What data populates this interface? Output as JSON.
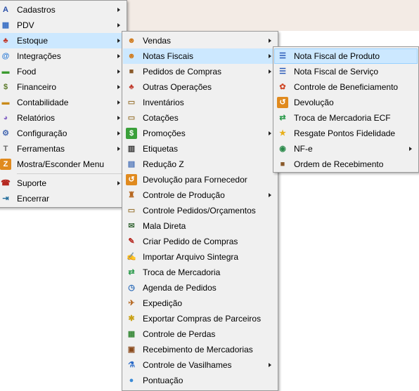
{
  "main_menu": {
    "items": [
      {
        "label": "Cadastros",
        "icon": "user-icon",
        "arrow": true
      },
      {
        "label": "PDV",
        "icon": "register-icon",
        "arrow": true
      },
      {
        "label": "Estoque",
        "icon": "stock-icon",
        "arrow": true,
        "open": true
      },
      {
        "label": "Integrações",
        "icon": "at-icon",
        "arrow": true
      },
      {
        "label": "Food",
        "icon": "basket-icon",
        "arrow": true
      },
      {
        "label": "Financeiro",
        "icon": "money-bag-icon",
        "arrow": true
      },
      {
        "label": "Contabilidade",
        "icon": "folder-icon",
        "arrow": true
      },
      {
        "label": "Relatórios",
        "icon": "chart-icon",
        "arrow": true
      },
      {
        "label": "Configuração",
        "icon": "gears-icon",
        "arrow": true
      },
      {
        "label": "Ferramentas",
        "icon": "hammer-icon",
        "arrow": true
      },
      {
        "label": "Mostra/Esconder Menu",
        "icon": "toggle-icon",
        "arrow": false
      },
      {
        "label": "Suporte",
        "icon": "phone-icon",
        "arrow": true,
        "separator_before": true
      },
      {
        "label": "Encerrar",
        "icon": "exit-icon",
        "arrow": false
      }
    ]
  },
  "estoque_menu": {
    "items": [
      {
        "label": "Vendas",
        "icon": "users-icon",
        "arrow": true
      },
      {
        "label": "Notas Fiscais",
        "icon": "users-icon",
        "arrow": true,
        "open": true
      },
      {
        "label": "Pedidos de Compras",
        "icon": "box-icon",
        "arrow": true
      },
      {
        "label": "Outras Operações",
        "icon": "stock-icon",
        "arrow": false
      },
      {
        "label": "Inventários",
        "icon": "clipboard-icon",
        "arrow": false
      },
      {
        "label": "Cotações",
        "icon": "clipboard-icon",
        "arrow": false
      },
      {
        "label": "Promoções",
        "icon": "dollar-icon",
        "arrow": true
      },
      {
        "label": "Etiquetas",
        "icon": "barcode-icon",
        "arrow": false
      },
      {
        "label": "Redução Z",
        "icon": "printer-icon",
        "arrow": false
      },
      {
        "label": "Devolução para Fornecedor",
        "icon": "return-icon",
        "arrow": false
      },
      {
        "label": "Controle de Produção",
        "icon": "production-icon",
        "arrow": true
      },
      {
        "label": "Controle Pedidos/Orçamentos",
        "icon": "clipboard-icon",
        "arrow": false
      },
      {
        "label": "Mala Direta",
        "icon": "mail-icon",
        "arrow": false
      },
      {
        "label": "Criar Pedido de Compras",
        "icon": "pen-icon",
        "arrow": false
      },
      {
        "label": "Importar Arquivo Sintegra",
        "icon": "import-icon",
        "arrow": false
      },
      {
        "label": "Troca de Mercadoria",
        "icon": "swap-icon",
        "arrow": false
      },
      {
        "label": "Agenda de Pedidos",
        "icon": "clock-icon",
        "arrow": false
      },
      {
        "label": "Expedição",
        "icon": "truck-icon",
        "arrow": false
      },
      {
        "label": "Exportar Compras de Parceiros",
        "icon": "bee-icon",
        "arrow": false
      },
      {
        "label": "Controle de Perdas",
        "icon": "sheet-icon",
        "arrow": false
      },
      {
        "label": "Recebimento de Mercadorias",
        "icon": "boxes-icon",
        "arrow": false
      },
      {
        "label": "Controle de Vasilhames",
        "icon": "flask-icon",
        "arrow": true
      },
      {
        "label": "Pontuação",
        "icon": "person-icon",
        "arrow": false
      }
    ]
  },
  "notas_menu": {
    "items": [
      {
        "label": "Nota Fiscal de Produto",
        "icon": "invoice-icon",
        "arrow": false,
        "highlight": true
      },
      {
        "label": "Nota Fiscal de Serviço",
        "icon": "invoice-icon",
        "arrow": false
      },
      {
        "label": "Controle de Beneficiamento",
        "icon": "cycle-icon",
        "arrow": false
      },
      {
        "label": "Devolução",
        "icon": "return-icon",
        "arrow": false
      },
      {
        "label": "Troca de Mercadoria ECF",
        "icon": "swap-icon",
        "arrow": false
      },
      {
        "label": "Resgate Pontos Fidelidade",
        "icon": "star-icon",
        "arrow": false
      },
      {
        "label": "NF-e",
        "icon": "globe-icon",
        "arrow": true
      },
      {
        "label": "Ordem de Recebimento",
        "icon": "box-icon",
        "arrow": false
      }
    ]
  },
  "icon_glyphs": {
    "user-icon": {
      "g": "A",
      "c": "#2a4fa8",
      "bg": "transparent"
    },
    "register-icon": {
      "g": "▦",
      "c": "#3a6fc4",
      "bg": "transparent"
    },
    "stock-icon": {
      "g": "♣",
      "c": "#c0392b",
      "bg": "transparent"
    },
    "at-icon": {
      "g": "@",
      "c": "#2c7bd6",
      "bg": "transparent"
    },
    "basket-icon": {
      "g": "▬",
      "c": "#3a9b2e",
      "bg": "transparent"
    },
    "money-bag-icon": {
      "g": "$",
      "c": "#5b7a2a",
      "bg": "transparent"
    },
    "folder-icon": {
      "g": "▬",
      "c": "#c98a1a",
      "bg": "transparent"
    },
    "chart-icon": {
      "g": "◕",
      "c": "#8a6cc8",
      "bg": "transparent"
    },
    "gears-icon": {
      "g": "⚙",
      "c": "#4a6cb3",
      "bg": "transparent"
    },
    "hammer-icon": {
      "g": "T",
      "c": "#6b6b6b",
      "bg": "transparent"
    },
    "toggle-icon": {
      "g": "Z",
      "c": "#ffffff",
      "bg": "#e08a1e"
    },
    "phone-icon": {
      "g": "☎",
      "c": "#b5261e",
      "bg": "transparent"
    },
    "exit-icon": {
      "g": "⇥",
      "c": "#1f6b9a",
      "bg": "transparent"
    },
    "users-icon": {
      "g": "☻",
      "c": "#d07a1c",
      "bg": "transparent"
    },
    "box-icon": {
      "g": "■",
      "c": "#8a5a2b",
      "bg": "transparent"
    },
    "clipboard-icon": {
      "g": "▭",
      "c": "#9c7a3c",
      "bg": "transparent"
    },
    "dollar-icon": {
      "g": "$",
      "c": "#ffffff",
      "bg": "#3aa03a"
    },
    "barcode-icon": {
      "g": "▥",
      "c": "#333333",
      "bg": "transparent"
    },
    "printer-icon": {
      "g": "▤",
      "c": "#4a72b8",
      "bg": "transparent"
    },
    "return-icon": {
      "g": "↺",
      "c": "#ffffff",
      "bg": "#e08a1e"
    },
    "production-icon": {
      "g": "♜",
      "c": "#b5651d",
      "bg": "transparent"
    },
    "mail-icon": {
      "g": "✉",
      "c": "#3a6a3a",
      "bg": "transparent"
    },
    "pen-icon": {
      "g": "✎",
      "c": "#b5261e",
      "bg": "transparent"
    },
    "import-icon": {
      "g": "✍",
      "c": "#3a5ab0",
      "bg": "transparent"
    },
    "swap-icon": {
      "g": "⇄",
      "c": "#2a9a4a",
      "bg": "transparent"
    },
    "clock-icon": {
      "g": "◷",
      "c": "#2a6ab8",
      "bg": "transparent"
    },
    "truck-icon": {
      "g": "✈",
      "c": "#b5651d",
      "bg": "transparent"
    },
    "bee-icon": {
      "g": "✱",
      "c": "#c9a21a",
      "bg": "transparent"
    },
    "sheet-icon": {
      "g": "▦",
      "c": "#3a8a3a",
      "bg": "transparent"
    },
    "boxes-icon": {
      "g": "▣",
      "c": "#8a4a1c",
      "bg": "transparent"
    },
    "flask-icon": {
      "g": "⚗",
      "c": "#2a6ac8",
      "bg": "transparent"
    },
    "person-icon": {
      "g": "●",
      "c": "#3a8ad6",
      "bg": "transparent"
    },
    "invoice-icon": {
      "g": "☰",
      "c": "#2a5ab8",
      "bg": "transparent"
    },
    "cycle-icon": {
      "g": "✿",
      "c": "#d04a2a",
      "bg": "transparent"
    },
    "star-icon": {
      "g": "★",
      "c": "#e8b01c",
      "bg": "transparent"
    },
    "globe-icon": {
      "g": "◉",
      "c": "#2a8a4a",
      "bg": "transparent"
    }
  }
}
